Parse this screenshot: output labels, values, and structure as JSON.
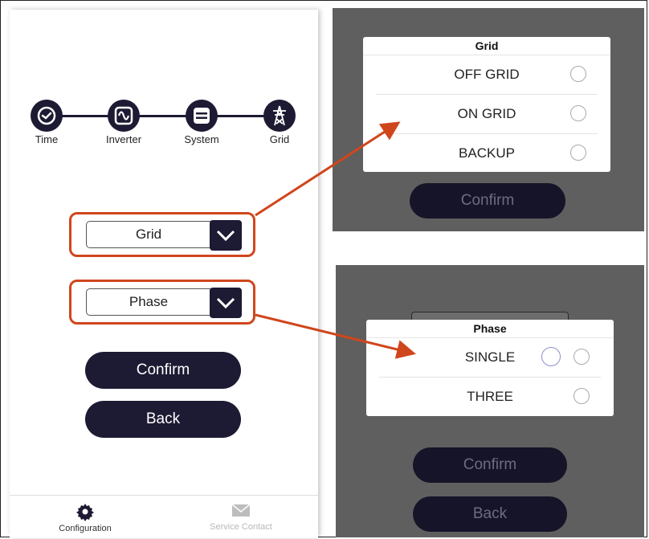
{
  "steps": [
    {
      "label": "Time",
      "icon": "clock-icon"
    },
    {
      "label": "Inverter",
      "icon": "sine-wave-icon"
    },
    {
      "label": "System",
      "icon": "system-icon"
    },
    {
      "label": "Grid",
      "icon": "power-tower-icon"
    }
  ],
  "selects": {
    "grid": {
      "value": "Grid"
    },
    "phase": {
      "value": "Phase"
    }
  },
  "buttons": {
    "confirm": "Confirm",
    "back": "Back"
  },
  "tabbar": {
    "configuration": "Configuration",
    "service_contact": "Service Contact"
  },
  "grid_dialog": {
    "title": "Grid",
    "options": [
      "OFF GRID",
      "ON GRID",
      "BACKUP"
    ],
    "confirm": "Confirm"
  },
  "phase_dialog": {
    "title": "Phase",
    "options": [
      "SINGLE",
      "THREE"
    ],
    "confirm": "Confirm",
    "back": "Back"
  },
  "colors": {
    "navy": "#1d1a33",
    "highlight": "#d0461c",
    "overlay": "#5f5f5f"
  }
}
